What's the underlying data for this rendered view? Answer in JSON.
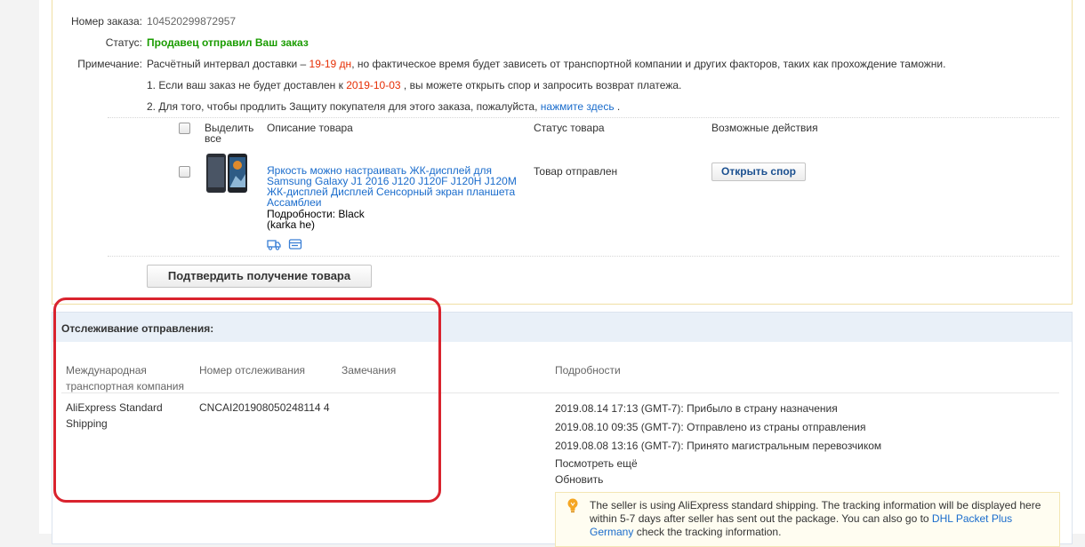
{
  "order": {
    "number_label": "Номер заказа:",
    "number": "104520299872957",
    "status_label": "Статус:",
    "status": "Продавец отправил Ваш заказ",
    "note_label": "Примечание:",
    "note_prefix": "Расчётный интервал доставки – ",
    "note_interval": "19-19 дн",
    "note_suffix": ", но фактическое время будет зависеть от транспортной компании и других факторов, таких как прохождение таможни.",
    "note1_prefix": "1. Если ваш заказ не будет доставлен к ",
    "note1_date": "2019-10-03",
    "note1_suffix": " , вы можете открыть спор и запросить возврат платежа.",
    "note2_prefix": "2. Для того, чтобы продлить Защиту покупателя для этого заказа, пожалуйста, ",
    "note2_link": "нажмите здесь",
    "note2_suffix": " ."
  },
  "product_table": {
    "headers": {
      "select_all": "Выделить все",
      "description": "Описание товара",
      "status": "Статус товара",
      "actions": "Возможные действия"
    },
    "item": {
      "title": "Яркость можно настраивать ЖК-дисплей для Samsung Galaxy J1 2016 J120 J120F J120H J120M ЖК-дисплей Дисплей Сенсорный экран планшета Ассамблеи",
      "details_line1": "Подробности: Black",
      "details_line2": "(karka he)",
      "status": "Товар отправлен",
      "dispute_button": "Открыть спор"
    },
    "confirm_button": "Подтвердить получение товара"
  },
  "tracking": {
    "title": "Отслеживание отправления:",
    "headers": {
      "company": "Международная транспортная компания",
      "tracking_number": "Номер отслеживания",
      "remarks": "Замечания",
      "details": "Подробности"
    },
    "company": "AliExpress Standard Shipping",
    "tracking_number": "CNCAI201908050248114 4",
    "events": [
      "2019.08.14 17:13 (GMT-7): Прибыло в страну назначения",
      "2019.08.10 09:35 (GMT-7): Отправлено из страны отправления",
      "2019.08.08 13:16 (GMT-7): Принято магистральным перевозчиком"
    ],
    "see_more": "Посмотреть ещё",
    "refresh": "Обновить",
    "notice_prefix": "The seller is using AliExpress standard shipping. The tracking information will be displayed here within 5-7 days after seller has sent out the package. You can also go to ",
    "notice_link": "DHL Packet Plus Germany",
    "notice_suffix": " check the tracking information."
  },
  "colors": {
    "status_green": "#1a9c00",
    "accent_red": "#e62e04",
    "link_blue": "#1a6ccc",
    "highlight_red": "#d9232e"
  }
}
